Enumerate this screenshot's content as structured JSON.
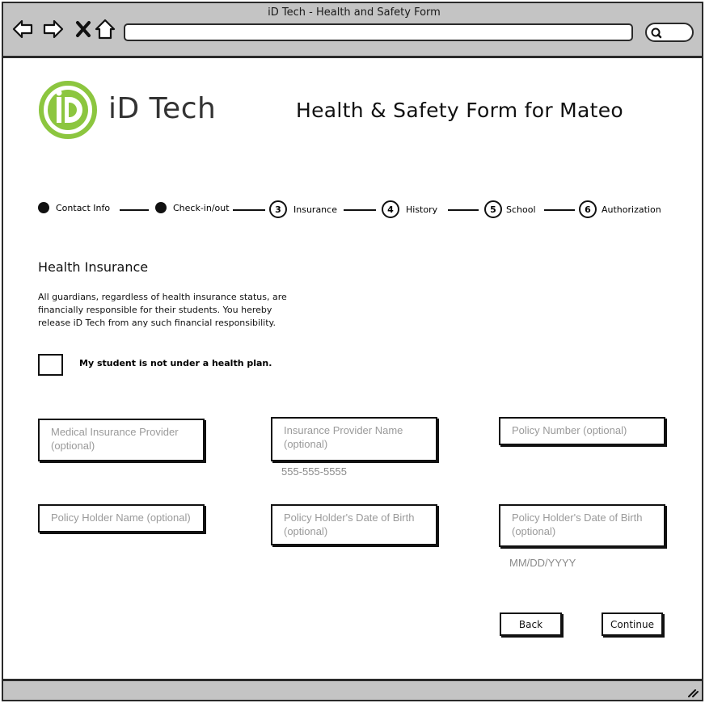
{
  "window": {
    "title": "iD Tech - Health and Safety Form"
  },
  "browser": {
    "back_icon": "back-arrow-icon",
    "forward_icon": "forward-arrow-icon",
    "stop_icon": "close-icon",
    "home_icon": "home-icon",
    "url": "",
    "search_icon": "search-icon"
  },
  "brand": {
    "name": "iD Tech",
    "logo_mark": "iD",
    "color": "#8cc63f"
  },
  "header": {
    "title": "Health & Safety Form for Mateo"
  },
  "steps": [
    {
      "num": "",
      "label": "Contact Info",
      "status": "done"
    },
    {
      "num": "",
      "label": "Check-in/out",
      "status": "done"
    },
    {
      "num": "3",
      "label": "Insurance",
      "status": "current"
    },
    {
      "num": "4",
      "label": "History",
      "status": "todo"
    },
    {
      "num": "5",
      "label": "School",
      "status": "todo"
    },
    {
      "num": "6",
      "label": "Authorization",
      "status": "todo"
    }
  ],
  "section": {
    "title": "Health Insurance",
    "description": "All guardians, regardless of health insurance status, are financially responsible for their students. You hereby release iD Tech from any such financial responsibility.",
    "checkbox_label": "My student is not under a health plan.",
    "checkbox_checked": false
  },
  "fields": {
    "provider": {
      "placeholder": "Medical Insurance Provider (optional)"
    },
    "provider_name": {
      "placeholder": "Insurance Provider Name (optional)",
      "hint": "555-555-5555"
    },
    "policy_number": {
      "placeholder": "Policy Number (optional)"
    },
    "holder_name": {
      "placeholder": "Policy Holder Name (optional)"
    },
    "holder_dob_1": {
      "placeholder": "Policy Holder's Date of Birth (optional)"
    },
    "holder_dob_2": {
      "placeholder": "Policy Holder's Date of Birth (optional)",
      "hint": "MM/DD/YYYY"
    }
  },
  "actions": {
    "back": "Back",
    "continue": "Continue"
  }
}
